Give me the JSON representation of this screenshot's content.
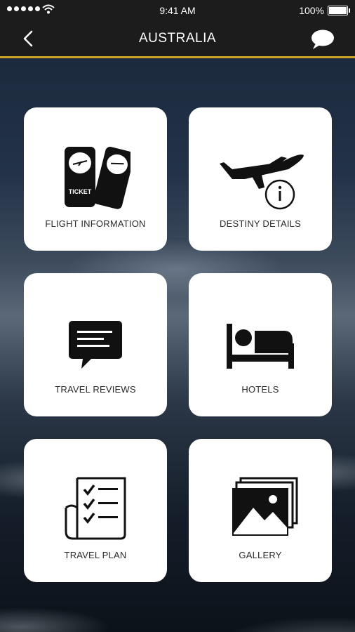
{
  "status_bar": {
    "time": "9:41 AM",
    "battery": "100%",
    "icons": [
      "signal-dots-icon",
      "wifi-icon",
      "battery-icon"
    ]
  },
  "nav": {
    "title": "AUSTRALIA",
    "back_icon": "chevron-left-icon",
    "chat_icon": "chat-bubble-icon",
    "accent_color": "#c9a227"
  },
  "tiles": [
    {
      "label": "FLIGHT INFORMATION",
      "icon": "ticket-icon"
    },
    {
      "label": "DESTINY DETAILS",
      "icon": "airplane-info-icon"
    },
    {
      "label": "TRAVEL REVIEWS",
      "icon": "review-message-icon"
    },
    {
      "label": "HOTELS",
      "icon": "bed-icon"
    },
    {
      "label": "TRAVEL PLAN",
      "icon": "checklist-icon"
    },
    {
      "label": "GALLERY",
      "icon": "gallery-icon"
    }
  ],
  "ticket_text": "TICKET"
}
